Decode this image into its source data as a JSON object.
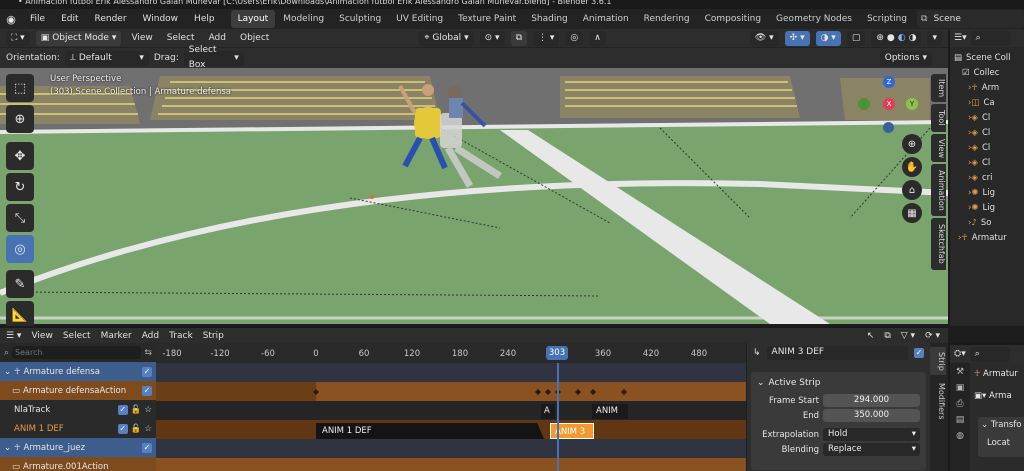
{
  "window": {
    "title": "• Animación fútbol Erik Alessandro Galán Muñevar [C:\\Users\\Erik\\Downloads\\Animación fútbol Erik Alessandro Galán Muñevar.blend] - Blender 3.6.1"
  },
  "menu": {
    "items": [
      "File",
      "Edit",
      "Render",
      "Window",
      "Help"
    ]
  },
  "workspaces": {
    "tabs": [
      "Layout",
      "Modeling",
      "Sculpting",
      "UV Editing",
      "Texture Paint",
      "Shading",
      "Animation",
      "Rendering",
      "Compositing",
      "Geometry Nodes",
      "Scripting"
    ],
    "active": "Layout"
  },
  "scene": {
    "label": "Scene"
  },
  "viewport_header": {
    "mode": "Object Mode",
    "menus": [
      "View",
      "Select",
      "Add",
      "Object"
    ],
    "transform_orientation": "Global",
    "orientation_label": "Orientation:",
    "orientation_value": "Default",
    "drag_label": "Drag:",
    "drag_value": "Select Box",
    "options": "Options"
  },
  "viewport": {
    "perspective": "User Perspective",
    "collection_info": "(303) Scene Collection | Armature defensa",
    "n_tabs": [
      "Item",
      "Tool",
      "View",
      "Animation",
      "Sketchfab"
    ],
    "gizmo_z": "Z",
    "gizmo_x": "X",
    "gizmo_y": "Y"
  },
  "nla_header": {
    "menus": [
      "View",
      "Select",
      "Marker",
      "Add",
      "Track",
      "Strip"
    ]
  },
  "nla": {
    "search_placeholder": "Search",
    "ruler": [
      "-180",
      "-120",
      "-60",
      "0",
      "60",
      "120",
      "180",
      "240",
      "300",
      "360",
      "420",
      "480"
    ],
    "current_frame": "303",
    "channels": [
      {
        "label": "Armature defensa",
        "type": "object"
      },
      {
        "label": "Armature defensaAction",
        "type": "action"
      },
      {
        "label": "NlaTrack",
        "type": "track"
      },
      {
        "label": "ANIM 1 DEF",
        "type": "track_active"
      },
      {
        "label": "Armature_juez",
        "type": "object"
      },
      {
        "label": "Armature.001Action",
        "type": "action"
      }
    ],
    "strips": {
      "anim1": "ANIM 1 DEF",
      "anim3_small": "ANIM 3",
      "a_small": "A",
      "anim_right": "ANIM"
    }
  },
  "strip_panel": {
    "name": "ANIM 3 DEF",
    "section": "Active Strip",
    "frame_start_label": "Frame Start",
    "frame_start": "294.000",
    "end_label": "End",
    "end": "350.000",
    "extrapolation_label": "Extrapolation",
    "extrapolation": "Hold",
    "blending_label": "Blending",
    "blending": "Replace",
    "tabs": [
      "Strip",
      "Modifiers"
    ]
  },
  "outliner": {
    "title": "Scene Coll",
    "items": [
      "Collec",
      "Arm",
      "Ca",
      "Cl",
      "Cl",
      "Cl",
      "Cl",
      "cri",
      "Lig",
      "Lig",
      "So",
      "Armatur"
    ]
  },
  "properties": {
    "items": [
      "Armatur",
      "Arma",
      "Transfo",
      "Locat"
    ]
  }
}
